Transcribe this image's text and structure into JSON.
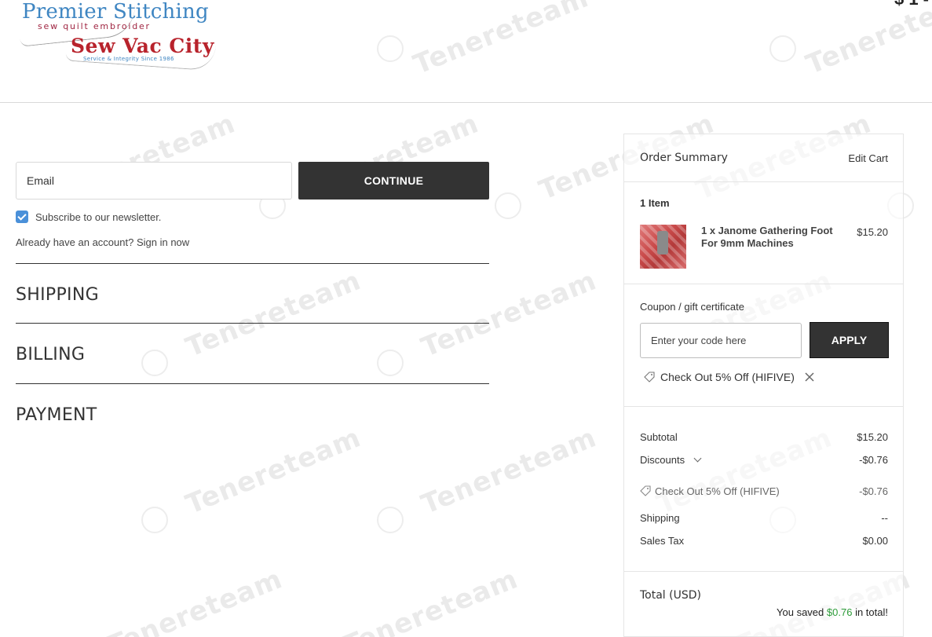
{
  "header": {
    "logo_title": "Premier Stitching",
    "logo_subtitle": "sew  quilt  embroider",
    "logo_brand": "Sew Vac City",
    "logo_tagline": "Service & Integrity Since 1986",
    "price_fragment": "$ 1 -"
  },
  "watermark_text": "Tenereteam",
  "checkout": {
    "email_placeholder": "Email",
    "continue_label": "CONTINUE",
    "newsletter_label": "Subscribe to our newsletter.",
    "newsletter_checked": true,
    "signin_prefix": "Already have an account?",
    "signin_link": "Sign in now",
    "sections": [
      "SHIPPING",
      "BILLING",
      "PAYMENT"
    ]
  },
  "summary": {
    "title": "Order Summary",
    "edit_cart": "Edit Cart",
    "items_count": "1 Item",
    "item": {
      "name": "1 x Janome Gathering Foot For 9mm Machines",
      "price": "$15.20"
    },
    "coupon_label": "Coupon / gift certificate",
    "coupon_placeholder": "Enter your code here",
    "apply_label": "APPLY",
    "applied_coupon": "Check Out 5% Off (HIFIVE)",
    "subtotal_label": "Subtotal",
    "subtotal_value": "$15.20",
    "discounts_label": "Discounts",
    "discounts_value": "-$0.76",
    "discount_line_label": "Check Out 5% Off (HIFIVE)",
    "discount_line_value": "-$0.76",
    "shipping_label": "Shipping",
    "shipping_value": "--",
    "tax_label": "Sales Tax",
    "tax_value": "$0.00",
    "total_label": "Total (USD)",
    "saved_prefix": "You saved",
    "saved_amount": "$0.76",
    "saved_suffix": "in total!"
  },
  "colors": {
    "button_dark": "#333333",
    "checkbox_blue": "#4a90d9",
    "saved_green": "#2e9d3a",
    "logo_blue": "#3f86c2",
    "logo_red": "#b8232c"
  }
}
